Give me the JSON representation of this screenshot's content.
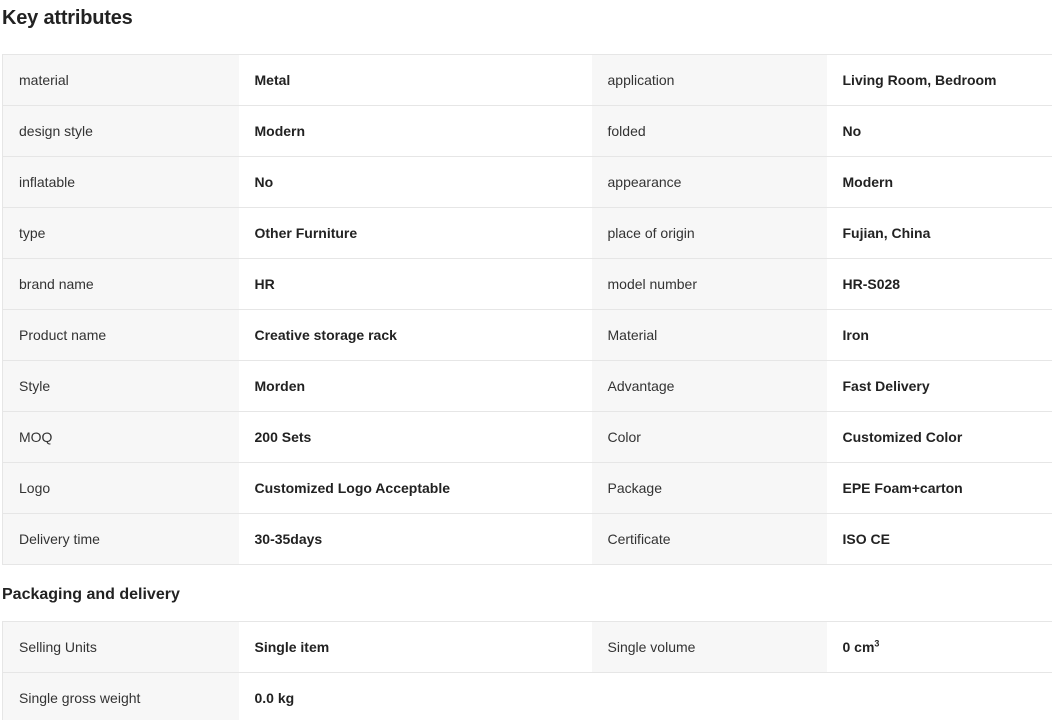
{
  "key_attributes": {
    "title": "Key attributes",
    "rows": [
      {
        "k1": "material",
        "v1": "Metal",
        "k2": "application",
        "v2": "Living Room, Bedroom"
      },
      {
        "k1": "design style",
        "v1": "Modern",
        "k2": "folded",
        "v2": "No"
      },
      {
        "k1": "inflatable",
        "v1": "No",
        "k2": "appearance",
        "v2": "Modern"
      },
      {
        "k1": "type",
        "v1": "Other Furniture",
        "k2": "place of origin",
        "v2": "Fujian, China"
      },
      {
        "k1": "brand name",
        "v1": "HR",
        "k2": "model number",
        "v2": "HR-S028"
      },
      {
        "k1": "Product name",
        "v1": "Creative storage rack",
        "k2": "Material",
        "v2": "Iron"
      },
      {
        "k1": "Style",
        "v1": "Morden",
        "k2": "Advantage",
        "v2": "Fast Delivery"
      },
      {
        "k1": "MOQ",
        "v1": "200 Sets",
        "k2": "Color",
        "v2": "Customized Color"
      },
      {
        "k1": "Logo",
        "v1": "Customized Logo Acceptable",
        "k2": "Package",
        "v2": "EPE Foam+carton"
      },
      {
        "k1": "Delivery time",
        "v1": "30-35days",
        "k2": "Certificate",
        "v2": "ISO CE"
      }
    ]
  },
  "packaging": {
    "title": "Packaging and delivery",
    "rows": [
      {
        "k1": "Selling Units",
        "v1": "Single item",
        "k2": "Single volume",
        "v2": "0 cm",
        "v2_sup": "3"
      },
      {
        "k1": "Single gross weight",
        "v1": "0.0 kg"
      }
    ]
  }
}
